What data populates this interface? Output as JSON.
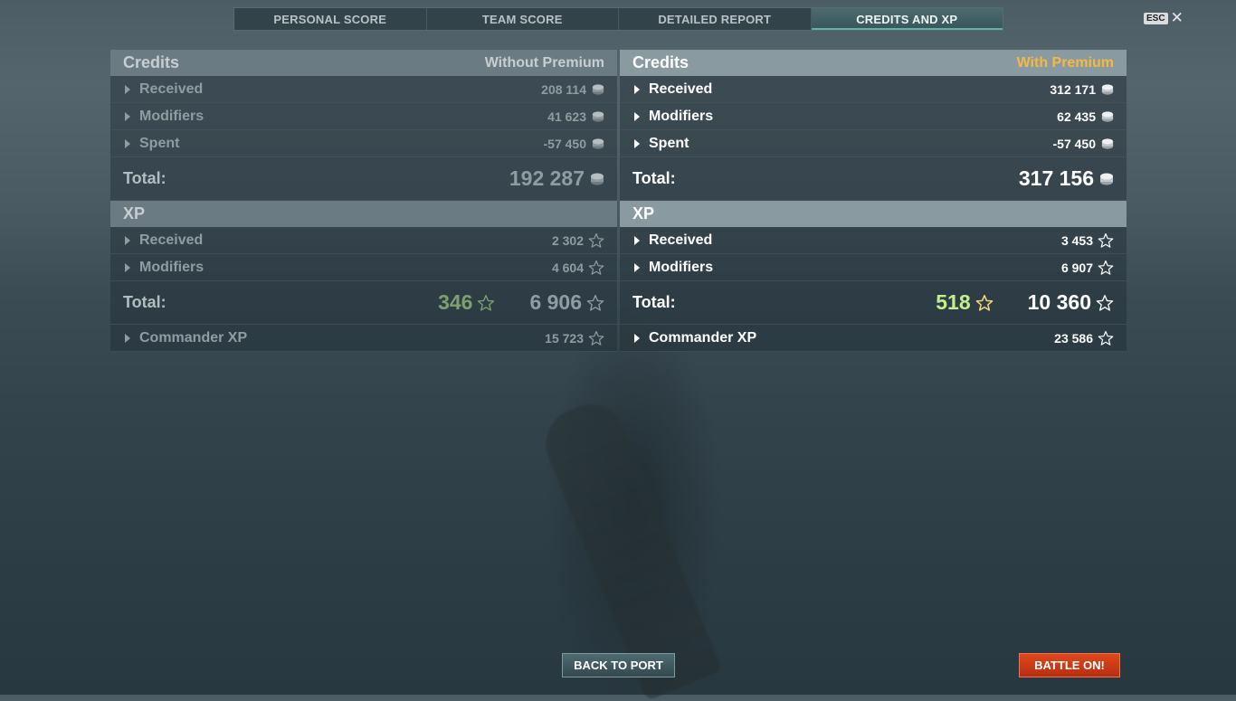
{
  "tabs": [
    "PERSONAL SCORE",
    "TEAM SCORE",
    "DETAILED REPORT",
    "CREDITS AND XP"
  ],
  "active_tab": "CREDITS AND XP",
  "close": {
    "key_label": "ESC",
    "icon": "close-icon"
  },
  "without_premium": {
    "credits": {
      "title": "Credits",
      "premium_label": "Without Premium",
      "rows": [
        {
          "label": "Received",
          "value": "208 114"
        },
        {
          "label": "Modifiers",
          "value": "41 623"
        },
        {
          "label": "Spent",
          "value": "-57 450"
        }
      ],
      "total_label": "Total:",
      "total_value": "192 287"
    },
    "xp": {
      "title": "XP",
      "rows": [
        {
          "label": "Received",
          "value": "2 302"
        },
        {
          "label": "Modifiers",
          "value": "4 604"
        }
      ],
      "total_label": "Total:",
      "free_xp": "346",
      "total_value": "6 906",
      "commander_label": "Commander XP",
      "commander_value": "15 723"
    }
  },
  "with_premium": {
    "credits": {
      "title": "Credits",
      "premium_label": "With Premium",
      "rows": [
        {
          "label": "Received",
          "value": "312 171"
        },
        {
          "label": "Modifiers",
          "value": "62 435"
        },
        {
          "label": "Spent",
          "value": "-57 450"
        }
      ],
      "total_label": "Total:",
      "total_value": "317 156"
    },
    "xp": {
      "title": "XP",
      "rows": [
        {
          "label": "Received",
          "value": "3 453"
        },
        {
          "label": "Modifiers",
          "value": "6 907"
        }
      ],
      "total_label": "Total:",
      "free_xp": "518",
      "total_value": "10 360",
      "commander_label": "Commander XP",
      "commander_value": "23 586"
    }
  },
  "buttons": {
    "back": "BACK TO PORT",
    "battle": "BATTLE ON!"
  },
  "icons": {
    "credits": "credits-coin-icon",
    "xp": "xp-star-icon",
    "expand": "expand-arrow-icon"
  },
  "colors": {
    "premium_accent": "#f5b942",
    "free_xp_premium": "#c4ef8a",
    "free_xp": "#7ea06e",
    "battle_button": "#d43c16",
    "active_tab": "#4c6a6f"
  }
}
